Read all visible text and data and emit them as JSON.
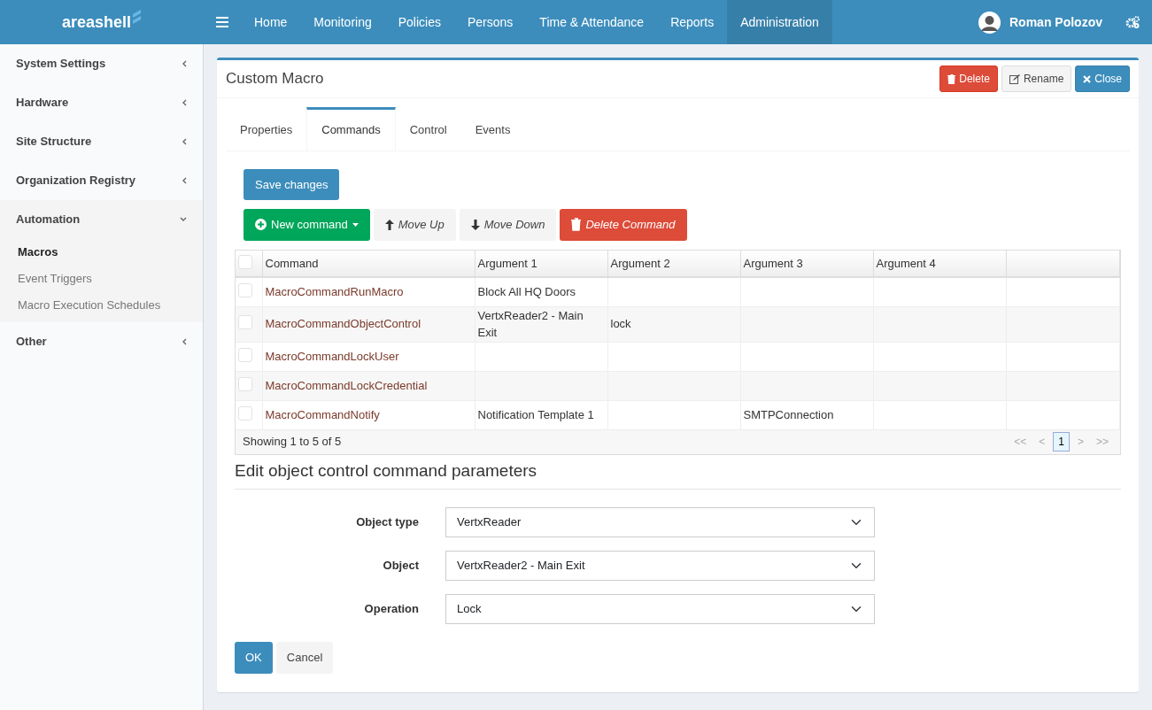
{
  "brand": "areashell",
  "nav": {
    "items": [
      {
        "label": "Home",
        "selected": false
      },
      {
        "label": "Monitoring",
        "selected": false
      },
      {
        "label": "Policies",
        "selected": false
      },
      {
        "label": "Persons",
        "selected": false
      },
      {
        "label": "Time & Attendance",
        "selected": false
      },
      {
        "label": "Reports",
        "selected": false
      },
      {
        "label": "Administration",
        "selected": true
      }
    ],
    "user": "Roman Polozov"
  },
  "sidebar": {
    "items": [
      {
        "label": "System Settings",
        "expanded": false
      },
      {
        "label": "Hardware",
        "expanded": false
      },
      {
        "label": "Site Structure",
        "expanded": false
      },
      {
        "label": "Organization Registry",
        "expanded": false
      },
      {
        "label": "Automation",
        "expanded": true,
        "children": [
          {
            "label": "Macros",
            "selected": true
          },
          {
            "label": "Event Triggers",
            "selected": false
          },
          {
            "label": "Macro Execution Schedules",
            "selected": false
          }
        ]
      },
      {
        "label": "Other",
        "expanded": false
      }
    ]
  },
  "panel": {
    "title": "Custom Macro",
    "buttons": [
      {
        "label": "Delete",
        "kind": "delete"
      },
      {
        "label": "Rename",
        "kind": "rename"
      },
      {
        "label": "Close",
        "kind": "close"
      }
    ]
  },
  "tabs": [
    {
      "label": "Properties",
      "selected": false
    },
    {
      "label": "Commands",
      "selected": true
    },
    {
      "label": "Control",
      "selected": false
    },
    {
      "label": "Events",
      "selected": false
    }
  ],
  "save_button": "Save changes",
  "toolbar": [
    {
      "label": "New command",
      "kind": "new"
    },
    {
      "label": "Move Up",
      "kind": "up"
    },
    {
      "label": "Move Down",
      "kind": "down"
    },
    {
      "label": "Delete Command",
      "kind": "delete"
    }
  ],
  "table": {
    "header_checked": false,
    "columns": [
      "Command",
      "Argument 1",
      "Argument 2",
      "Argument 3",
      "Argument 4"
    ],
    "rows": [
      {
        "checked": false,
        "cells": [
          "MacroCommandRunMacro",
          "Block All HQ Doors",
          "",
          "",
          ""
        ]
      },
      {
        "checked": false,
        "cells": [
          "MacroCommandObjectControl",
          "VertxReader2 - Main Exit",
          "lock",
          "",
          ""
        ]
      },
      {
        "checked": false,
        "cells": [
          "MacroCommandLockUser",
          "",
          "",
          "",
          ""
        ]
      },
      {
        "checked": false,
        "cells": [
          "MacroCommandLockCredential",
          "",
          "",
          "",
          ""
        ]
      },
      {
        "checked": false,
        "cells": [
          "MacroCommandNotify",
          "Notification Template 1",
          "",
          "SMTPConnection",
          ""
        ]
      }
    ],
    "footer": "Showing 1 to 5 of 5",
    "pagination": [
      {
        "label": "<<",
        "selected": false
      },
      {
        "label": "<",
        "selected": false
      },
      {
        "label": "1",
        "selected": true
      },
      {
        "label": ">",
        "selected": false
      },
      {
        "label": ">>",
        "selected": false
      }
    ]
  },
  "form": {
    "title": "Edit object control command parameters",
    "fields": [
      {
        "label": "Object type",
        "value": "VertxReader"
      },
      {
        "label": "Object",
        "value": "VertxReader2 - Main Exit"
      },
      {
        "label": "Operation",
        "value": "Lock"
      }
    ],
    "buttons": [
      {
        "label": "OK",
        "kind": "primary"
      },
      {
        "label": "Cancel",
        "kind": "default"
      }
    ]
  }
}
